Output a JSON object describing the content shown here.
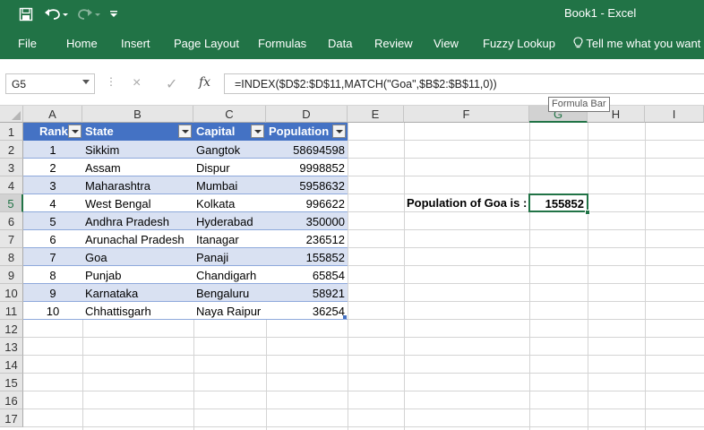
{
  "titlebar": {
    "title": "Book1  -  Excel",
    "save_icon": "save-icon",
    "undo_icon": "undo-icon",
    "redo_icon": "redo-icon",
    "customize_icon": "customize-qat-icon"
  },
  "ribbon": {
    "tabs": [
      "File",
      "Home",
      "Insert",
      "Page Layout",
      "Formulas",
      "Data",
      "Review",
      "View",
      "Fuzzy Lookup"
    ],
    "tell_me": "Tell me what you want to",
    "tell_me_icon": "lightbulb-icon"
  },
  "formula_bar": {
    "name_box": "G5",
    "cancel_icon": "×",
    "enter_icon": "✓",
    "fx_label": "fx",
    "formula": "=INDEX($D$2:$D$11,MATCH(\"Goa\",$B$2:$B$11,0))",
    "tooltip": "Formula Bar"
  },
  "grid": {
    "columns": [
      "A",
      "B",
      "C",
      "D",
      "E",
      "F",
      "G",
      "H",
      "I"
    ],
    "selected_column": "G",
    "rows": [
      "1",
      "2",
      "3",
      "4",
      "5",
      "6",
      "7",
      "8",
      "9",
      "10",
      "11",
      "12",
      "13",
      "14",
      "15",
      "16",
      "17"
    ],
    "selected_row": "5"
  },
  "table": {
    "headers": [
      "Rank",
      "State",
      "Capital",
      "Population"
    ],
    "rows": [
      [
        "1",
        "Sikkim",
        "Gangtok",
        "58694598"
      ],
      [
        "2",
        "Assam",
        "Dispur",
        "9998852"
      ],
      [
        "3",
        "Maharashtra",
        "Mumbai",
        "5958632"
      ],
      [
        "4",
        "West Bengal",
        "Kolkata",
        "996622"
      ],
      [
        "5",
        "Andhra Pradesh",
        "Hyderabad",
        "350000"
      ],
      [
        "6",
        "Arunachal Pradesh",
        "Itanagar",
        "236512"
      ],
      [
        "7",
        "Goa",
        "Panaji",
        "155852"
      ],
      [
        "8",
        "Punjab",
        "Chandigarh",
        "65854"
      ],
      [
        "9",
        "Karnataka",
        "Bengaluru",
        "58921"
      ],
      [
        "10",
        "Chhattisgarh",
        "Naya Raipur",
        "36254"
      ]
    ],
    "header_color": "#4472c4",
    "band_color": "#d9e1f2"
  },
  "result": {
    "label": "Population of Goa is :",
    "value": "155852"
  }
}
